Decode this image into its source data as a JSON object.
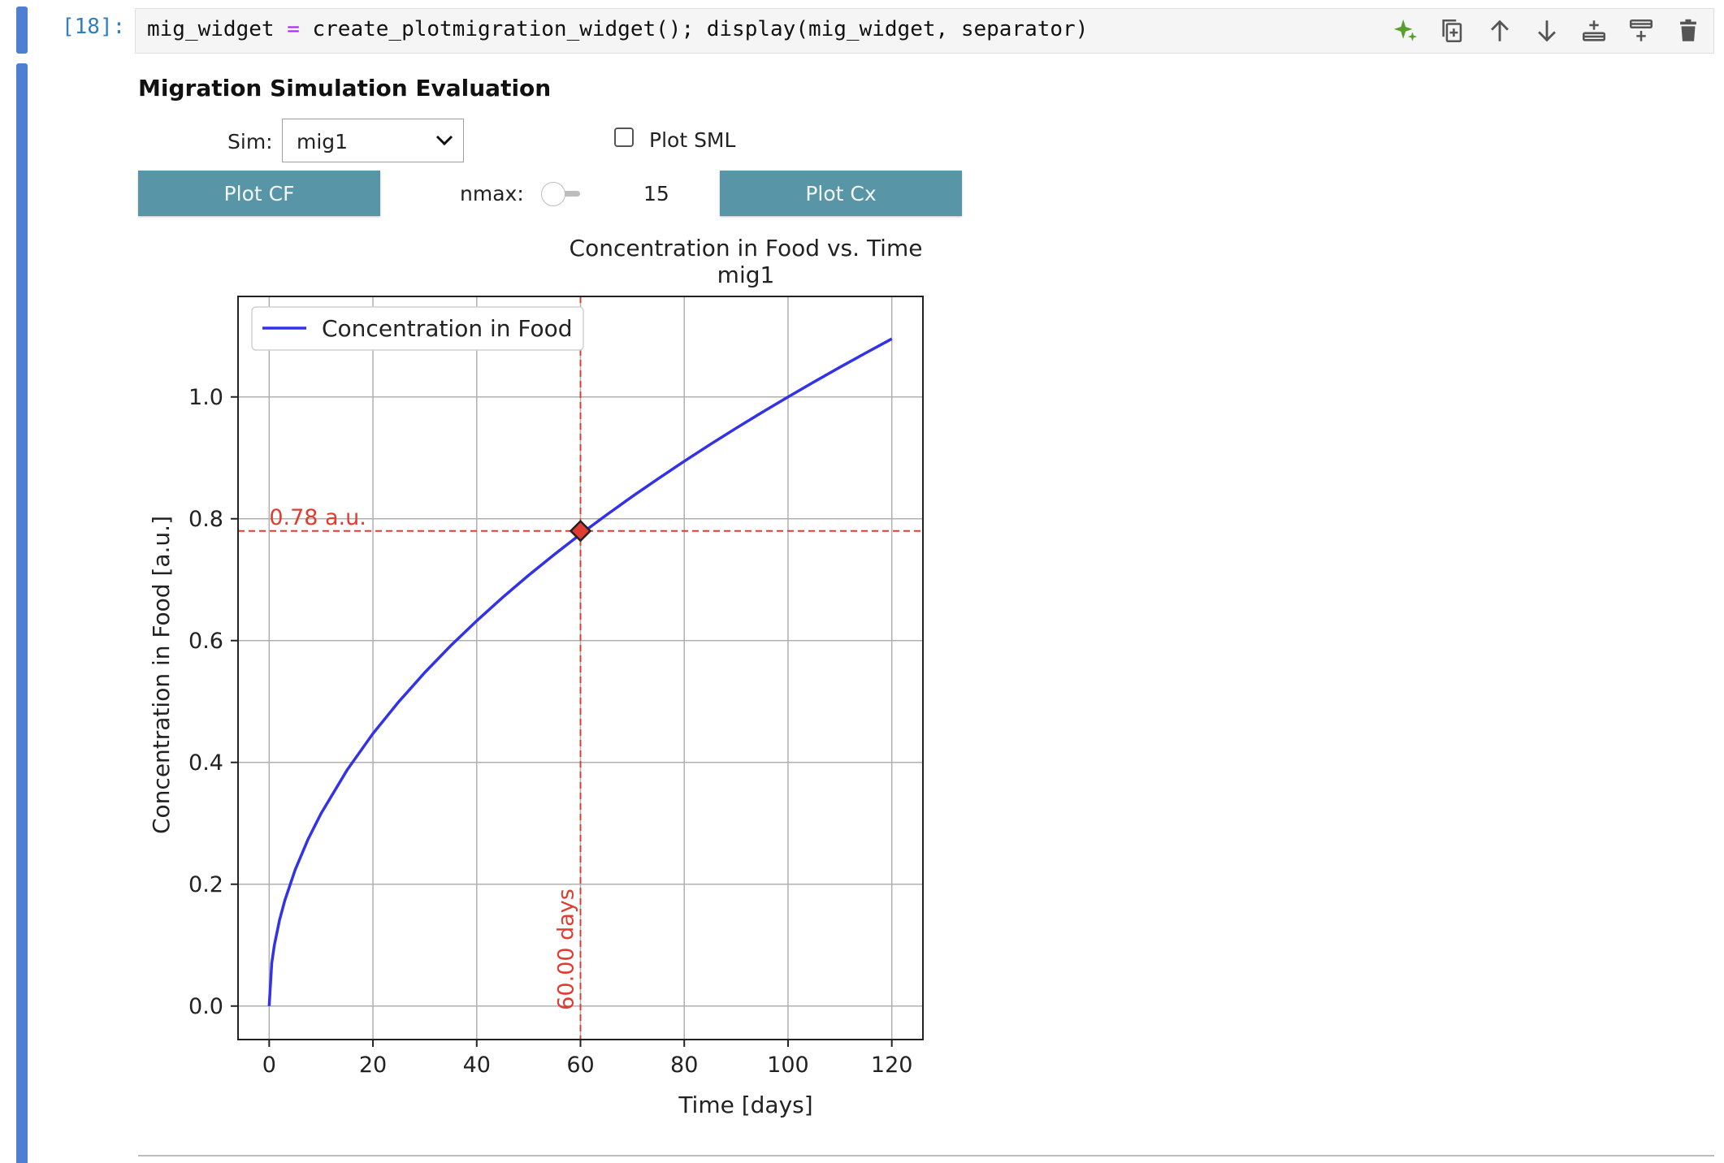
{
  "cell": {
    "prompt": "[18]:",
    "code_var": "mig_widget ",
    "code_op": "=",
    "code_rest": " create_plotmigration_widget(); display(mig_widget, separator)"
  },
  "toolbar": {
    "icons": [
      "sparkle-icon",
      "duplicate-icon",
      "move-up-icon",
      "move-down-icon",
      "insert-below-icon",
      "insert-above-icon",
      "delete-icon"
    ],
    "colors": {
      "sparkle": "#5a9e2f",
      "icon": "#555555"
    }
  },
  "widget": {
    "title": "Migration Simulation Evaluation",
    "sim_label": "Sim:",
    "sim_value": "mig1",
    "plot_sml_label": "Plot SML",
    "plot_sml_checked": false,
    "plot_cf_label": "Plot CF",
    "nmax_label": "nmax:",
    "nmax_value": "15",
    "plot_cx_label": "Plot Cx",
    "button_color": "#5895a6"
  },
  "chart_data": {
    "type": "line",
    "title": "Concentration in Food vs. Time",
    "subtitle": "mig1",
    "xlabel": "Time [days]",
    "ylabel": "Concentration in Food [a.u.]",
    "xlim": [
      -6,
      126
    ],
    "ylim": [
      -0.055,
      1.165
    ],
    "xticks": [
      0,
      20,
      40,
      60,
      80,
      100,
      120
    ],
    "yticks": [
      0.0,
      0.2,
      0.4,
      0.6,
      0.8,
      1.0
    ],
    "xtick_labels": [
      "0",
      "20",
      "40",
      "60",
      "80",
      "100",
      "120"
    ],
    "ytick_labels": [
      "0.0",
      "0.2",
      "0.4",
      "0.6",
      "0.8",
      "1.0"
    ],
    "grid": true,
    "legend": {
      "position": "top-left",
      "label": "Concentration in Food"
    },
    "series": [
      {
        "name": "Concentration in Food",
        "color": "#3232e8",
        "x": [
          0,
          0.5,
          1,
          2,
          3,
          5,
          7.5,
          10,
          15,
          20,
          25,
          30,
          35,
          40,
          45,
          50,
          55,
          60,
          65,
          70,
          75,
          80,
          85,
          90,
          95,
          100,
          105,
          110,
          115,
          120
        ],
        "y": [
          0,
          0.0707,
          0.1,
          0.1414,
          0.1732,
          0.2236,
          0.2739,
          0.3162,
          0.3873,
          0.4472,
          0.5,
          0.5477,
          0.5916,
          0.6325,
          0.6708,
          0.7071,
          0.7416,
          0.7746,
          0.8062,
          0.8367,
          0.866,
          0.8944,
          0.922,
          0.9487,
          0.9747,
          1.0,
          1.0247,
          1.0488,
          1.0724,
          1.0954
        ]
      }
    ],
    "annotation": {
      "x": 60,
      "y": 0.78,
      "color": "#e03c31",
      "hline_label": "0.78 a.u.",
      "vline_label": "60.00 days"
    }
  }
}
